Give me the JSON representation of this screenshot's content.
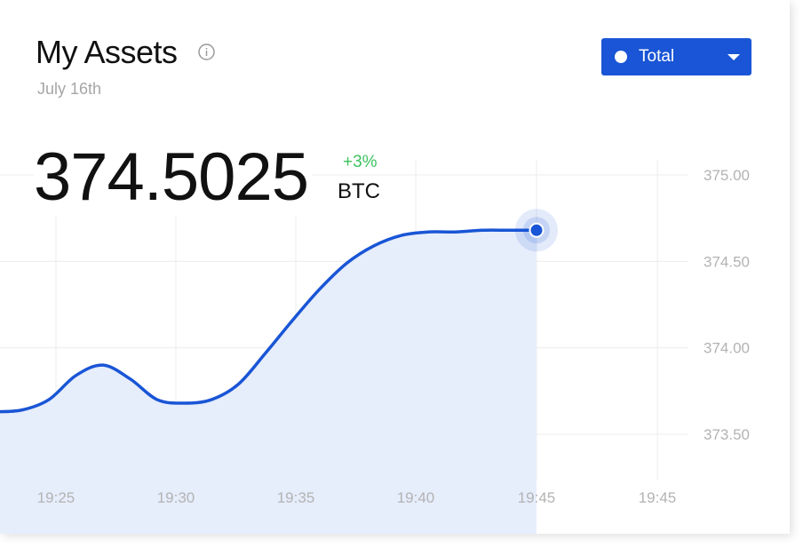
{
  "header": {
    "title": "My Assets",
    "date": "July 16th"
  },
  "filter": {
    "selected": "Total"
  },
  "summary": {
    "value": "374.5025",
    "change": "+3%",
    "unit": "BTC"
  },
  "colors": {
    "accent": "#1955d6",
    "area_fill": "#e6edfb",
    "positive": "#3dc25f",
    "grid": "#ececec",
    "tick": "#b3b3b3"
  },
  "icons": {
    "info": "info-circle-icon",
    "dropdown": "caret-down-icon"
  },
  "chart_data": {
    "type": "area",
    "x_tick_labels": [
      "19:25",
      "19:30",
      "19:35",
      "19:40",
      "19:45",
      "19:45"
    ],
    "y_tick_labels": [
      "375.00",
      "374.50",
      "374.00",
      "373.50"
    ],
    "y_ticks": [
      375.0,
      374.5,
      374.0,
      373.5
    ],
    "ylim": [
      373.3,
      375.0
    ],
    "grid": true,
    "series": [
      {
        "x": [
          0,
          5,
          10,
          15,
          20,
          25,
          30,
          35,
          40,
          45,
          50,
          55,
          60,
          65,
          70,
          75,
          80,
          85,
          90,
          95,
          100
        ],
        "y": [
          373.63,
          373.64,
          373.7,
          373.84,
          373.9,
          373.82,
          373.7,
          373.68,
          373.7,
          373.79,
          373.97,
          374.16,
          374.34,
          374.49,
          374.59,
          374.65,
          374.67,
          374.67,
          374.68,
          374.68,
          374.68
        ]
      }
    ]
  }
}
